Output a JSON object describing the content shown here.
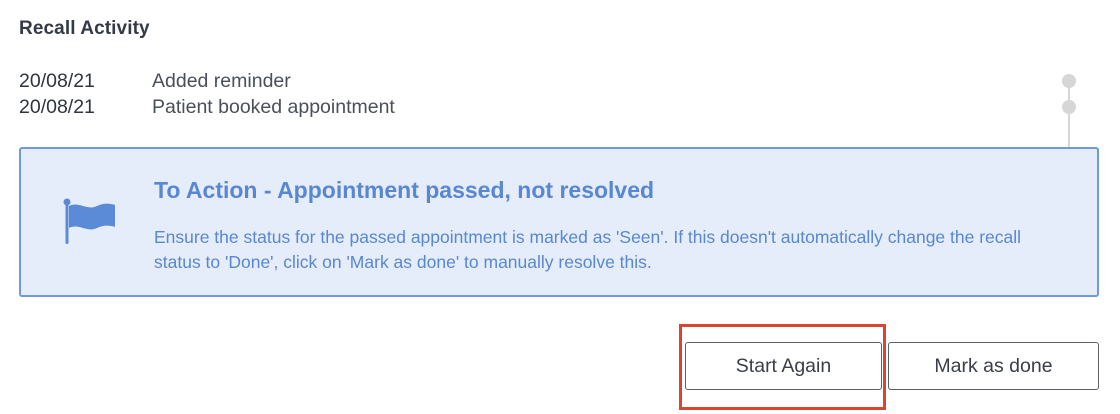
{
  "section": {
    "title": "Recall Activity"
  },
  "activity": [
    {
      "date": "20/08/21",
      "text": "Added reminder"
    },
    {
      "date": "20/08/21",
      "text": "Patient booked appointment"
    }
  ],
  "alert": {
    "icon": "flag-icon",
    "title": "To Action - Appointment passed, not resolved",
    "body": "Ensure the status for the passed appointment is marked as 'Seen'. If this doesn't automatically change the recall status to 'Done', click on 'Mark as done' to manually resolve this."
  },
  "actions": {
    "start_again_label": "Start Again",
    "mark_done_label": "Mark as done"
  },
  "colors": {
    "accent": "#5b8bd6",
    "alert_background": "#e4edf9",
    "highlight": "#d9452e",
    "timeline_inactive": "#d6d6d6"
  }
}
